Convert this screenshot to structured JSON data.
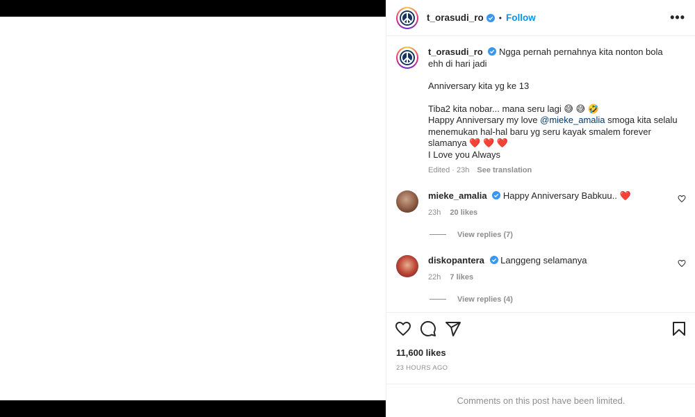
{
  "post": {
    "username": "t_orasudi_ro",
    "follow_label": "Follow",
    "separator": "•",
    "more_label": "•••"
  },
  "caption": {
    "username": "t_orasudi_ro",
    "line1": "Ngga pernah pernahnya kita nonton bola ehh di hari jadi",
    "line2": "Anniversary kita yg ke 13",
    "line3": "Tiba2 kita nobar... mana seru lagi 😅 😅 🤣",
    "line4_prefix": "Happy Anniversary my love ",
    "line4_mention": "@mieke_amalia",
    "line4_suffix": " smoga kita selalu menemukan hal-hal baru yg seru kayak smalem forever slamanya ❤️ ❤️ ❤️",
    "line5": "I Love you Always",
    "edited": "Edited · 23h",
    "see_translation": "See translation"
  },
  "comments": [
    {
      "username": "mieke_amalia",
      "text": "Happy Anniversary Babkuu.. ❤️",
      "time": "23h",
      "likes": "20 likes",
      "view_replies": "View replies (7)"
    },
    {
      "username": "diskopantera",
      "text": "Langgeng selamanya",
      "time": "22h",
      "likes": "7 likes",
      "view_replies": "View replies (4)"
    }
  ],
  "actions": {
    "likes_count": "11,600 likes",
    "posted_time": "23 HOURS AGO"
  },
  "footer": {
    "limited_text": "Comments on this post have been limited."
  },
  "colors": {
    "accent": "#0095f6",
    "verified": "#3897f0",
    "muted": "#8e8e8e",
    "heart": "#ed1c24"
  },
  "icons": [
    "peace-sign-icon",
    "verified-badge-icon",
    "more-options-icon",
    "heart-icon",
    "comment-icon",
    "share-icon",
    "bookmark-icon"
  ]
}
